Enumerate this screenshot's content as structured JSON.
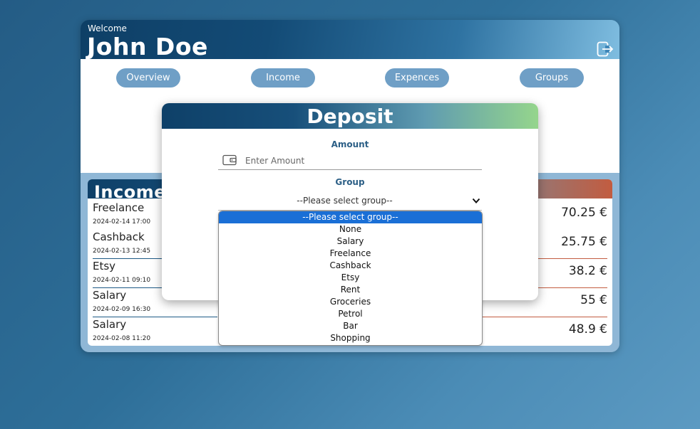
{
  "header": {
    "welcome": "Welcome",
    "username": "John Doe",
    "logout_icon": "logout-icon"
  },
  "nav": {
    "overview": "Overview",
    "income": "Income",
    "expences": "Expences",
    "groups": "Groups"
  },
  "income": {
    "title": "Income",
    "entries": [
      {
        "name": "Freelance",
        "date": "2024-02-14 17:00",
        "amount": "70.25 €"
      },
      {
        "name": "Cashback",
        "date": "2024-02-13 12:45",
        "amount": "25.75 €"
      },
      {
        "name": "Etsy",
        "date": "2024-02-11 09:10",
        "amount": "38.2 €"
      },
      {
        "name": "Salary",
        "date": "2024-02-09 16:30",
        "amount": "55 €"
      },
      {
        "name": "Salary",
        "date": "2024-02-08 11:20",
        "amount": "48.9 €"
      }
    ]
  },
  "modal": {
    "title": "Deposit",
    "amount_label": "Amount",
    "amount_placeholder": "Enter Amount",
    "amount_icon": "wallet-icon",
    "group_label": "Group",
    "group_selected": "--Please select group--"
  },
  "dropdown": {
    "options": [
      "--Please select group--",
      "None",
      "Salary",
      "Freelance",
      "Cashback",
      "Etsy",
      "Rent",
      "Groceries",
      "Petrol",
      "Bar",
      "Shopping"
    ],
    "highlighted": "--Please select group--"
  },
  "colors": {
    "accent": "#0e4068",
    "nav_button": "#6f9fc6",
    "expense": "#c25c40",
    "highlight": "#1a6fd6"
  }
}
